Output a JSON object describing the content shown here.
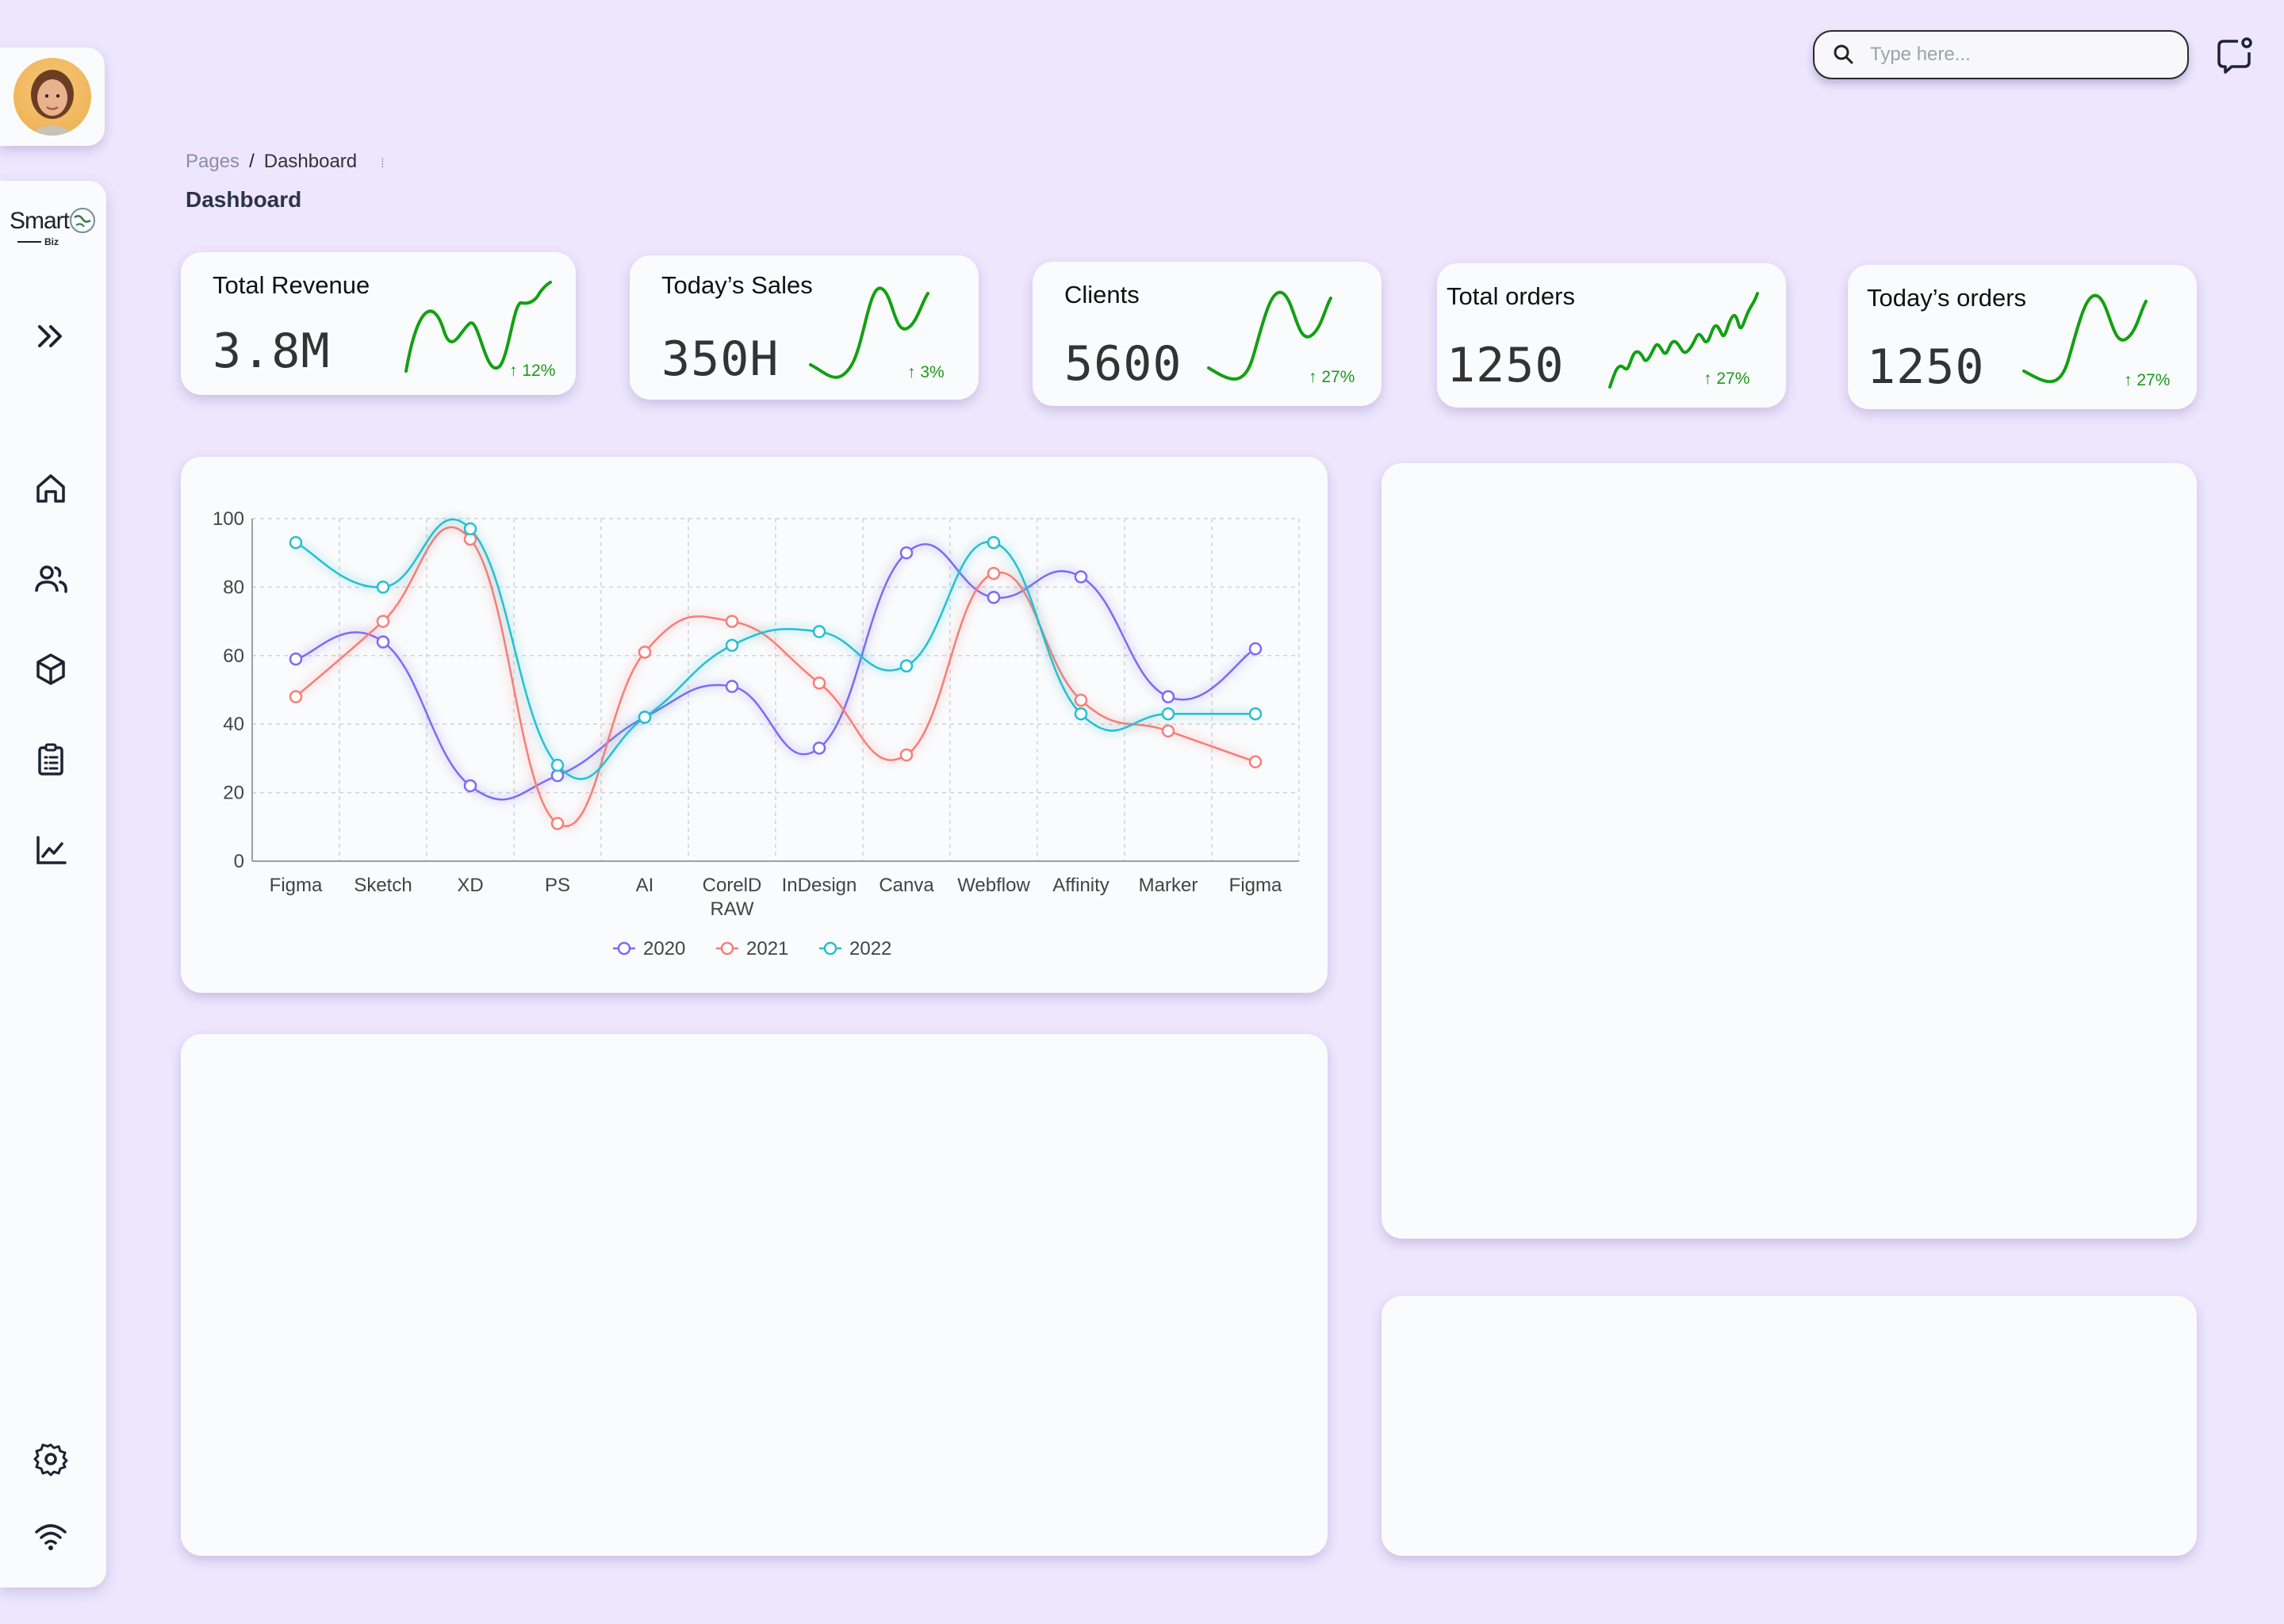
{
  "header": {
    "search_placeholder": "Type here...",
    "notification_icon": "message-notification-icon"
  },
  "breadcrumb": {
    "root": "Pages",
    "separator": "/",
    "current": "Dashboard"
  },
  "page_title": "Dashboard",
  "sidebar": {
    "logo_text": "Smart",
    "logo_sub": "Biz",
    "icons": [
      "expand-icon",
      "home-icon",
      "users-icon",
      "box-icon",
      "clipboard-icon",
      "chart-icon",
      "settings-icon",
      "wifi-icon"
    ]
  },
  "stats": [
    {
      "label": "Total Revenue",
      "value": "3.8M",
      "change": "↑ 12%"
    },
    {
      "label": "Today’s Sales",
      "value": "350H",
      "change": "↑ 3%"
    },
    {
      "label": "Clients",
      "value": "5600",
      "change": "↑ 27%"
    },
    {
      "label": "Total orders",
      "value": "1250",
      "change": "↑ 27%"
    },
    {
      "label": "Today’s orders",
      "value": "1250",
      "change": "↑ 27%"
    }
  ],
  "colors": {
    "background": "#ede6fd",
    "card": "#fafbfc",
    "positive": "#1a9a1a",
    "series_2020": "#7b6cf0",
    "series_2021": "#f47f7a",
    "series_2022": "#27bfd0"
  },
  "chart_data": {
    "type": "line",
    "categories": [
      "Figma",
      "Sketch",
      "XD",
      "PS",
      "AI",
      "CorelD RAW",
      "InDesign",
      "Canva",
      "Webflow",
      "Affinity",
      "Marker",
      "Figma"
    ],
    "ylim": [
      0,
      100
    ],
    "yticks": [
      0,
      20,
      40,
      60,
      80,
      100
    ],
    "grid": true,
    "legend": "bottom",
    "series": [
      {
        "name": "2020",
        "values": [
          59,
          64,
          22,
          25,
          42,
          51,
          33,
          90,
          77,
          83,
          48,
          62
        ]
      },
      {
        "name": "2021",
        "values": [
          48,
          70,
          94,
          11,
          61,
          70,
          52,
          31,
          84,
          47,
          38,
          29
        ]
      },
      {
        "name": "2022",
        "values": [
          93,
          80,
          97,
          28,
          42,
          63,
          67,
          57,
          93,
          43,
          43,
          43
        ]
      }
    ]
  }
}
